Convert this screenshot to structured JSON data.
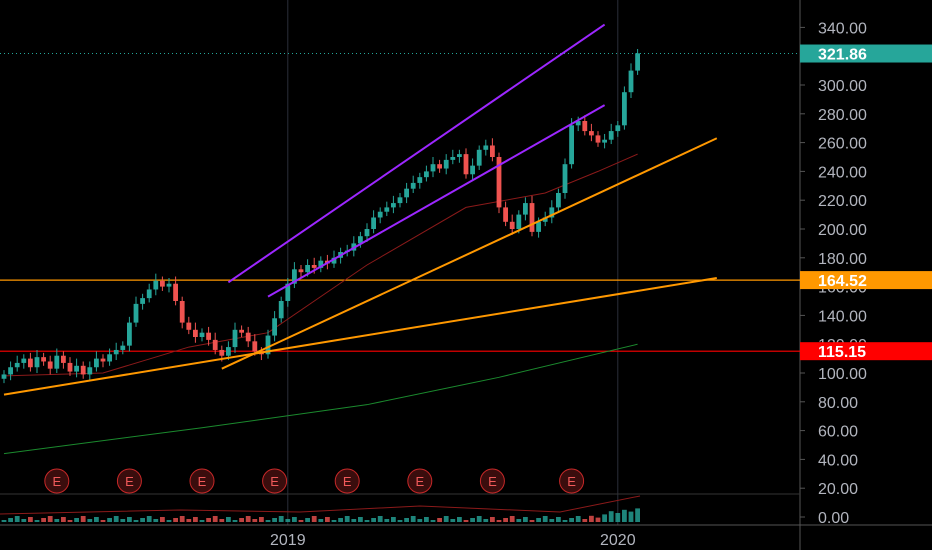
{
  "chart_data": {
    "type": "candlestick",
    "y_ticks": [
      "340.00",
      "320.00",
      "300.00",
      "280.00",
      "260.00",
      "240.00",
      "220.00",
      "200.00",
      "180.00",
      "160.00",
      "140.00",
      "120.00",
      "100.00",
      "80.00",
      "60.00",
      "40.00",
      "20.00",
      "0.00"
    ],
    "y_tick_values": [
      340,
      320,
      300,
      280,
      260,
      240,
      220,
      200,
      180,
      160,
      140,
      120,
      100,
      80,
      60,
      40,
      20,
      0
    ],
    "x_labels": [
      {
        "label": "2019",
        "date": "2019-01-01"
      },
      {
        "label": "2020",
        "date": "2020-01-01"
      }
    ],
    "price_badges": [
      {
        "label": "321.86",
        "value": 321.86,
        "color": "#26a69a"
      },
      {
        "label": "164.52",
        "value": 164.52,
        "color": "#ff9800"
      },
      {
        "label": "115.15",
        "value": 115.15,
        "color": "#ff0000"
      }
    ],
    "horizontal_lines": [
      {
        "value": 164.52,
        "color": "#ff9800"
      },
      {
        "value": 115.15,
        "color": "#ff0000"
      }
    ],
    "trend_lines": [
      {
        "color": "#9c27ff",
        "p1": {
          "week": 34,
          "value": 163
        },
        "p2": {
          "week": 91,
          "value": 342
        }
      },
      {
        "color": "#9c27ff",
        "p1": {
          "week": 40,
          "value": 153
        },
        "p2": {
          "week": 91,
          "value": 286
        }
      },
      {
        "color": "#ff9800",
        "p1": {
          "week": 33,
          "value": 103
        },
        "p2": {
          "week": 108,
          "value": 263
        }
      },
      {
        "color": "#ff9800",
        "p1": {
          "week": 0,
          "value": 85
        },
        "p2": {
          "week": 108,
          "value": 166
        }
      }
    ],
    "earnings_markers": [
      "E",
      "E",
      "E",
      "E",
      "E",
      "E",
      "E",
      "E"
    ],
    "earnings_weeks": [
      8,
      19,
      30,
      41,
      52,
      63,
      74,
      86
    ],
    "weekly_closes": [
      99,
      104,
      107,
      110,
      104,
      111,
      108,
      103,
      112,
      107,
      101,
      105,
      99,
      104,
      110,
      108,
      113,
      116,
      119,
      135,
      148,
      152,
      158,
      164,
      160,
      162,
      150,
      135,
      130,
      125,
      128,
      123,
      116,
      112,
      118,
      130,
      128,
      122,
      115,
      113,
      126,
      138,
      150,
      162,
      172,
      170,
      175,
      173,
      178,
      176,
      180,
      184,
      185,
      190,
      195,
      200,
      208,
      212,
      215,
      218,
      222,
      228,
      232,
      236,
      240,
      245,
      242,
      248,
      250,
      252,
      238,
      244,
      255,
      258,
      250,
      215,
      205,
      200,
      210,
      218,
      198,
      205,
      208,
      215,
      225,
      245,
      272,
      275,
      268,
      265,
      260,
      262,
      268,
      272,
      295,
      310,
      322
    ],
    "ma_short": [
      {
        "week": 0,
        "value": 98
      },
      {
        "week": 15,
        "value": 100
      },
      {
        "week": 28,
        "value": 118
      },
      {
        "week": 40,
        "value": 128
      },
      {
        "week": 55,
        "value": 175
      },
      {
        "week": 70,
        "value": 215
      },
      {
        "week": 82,
        "value": 225
      },
      {
        "week": 90,
        "value": 240
      },
      {
        "week": 96,
        "value": 252
      }
    ],
    "ma_long": [
      {
        "week": 0,
        "value": 44
      },
      {
        "week": 30,
        "value": 62
      },
      {
        "week": 55,
        "value": 78
      },
      {
        "week": 75,
        "value": 97
      },
      {
        "week": 96,
        "value": 120
      }
    ]
  }
}
